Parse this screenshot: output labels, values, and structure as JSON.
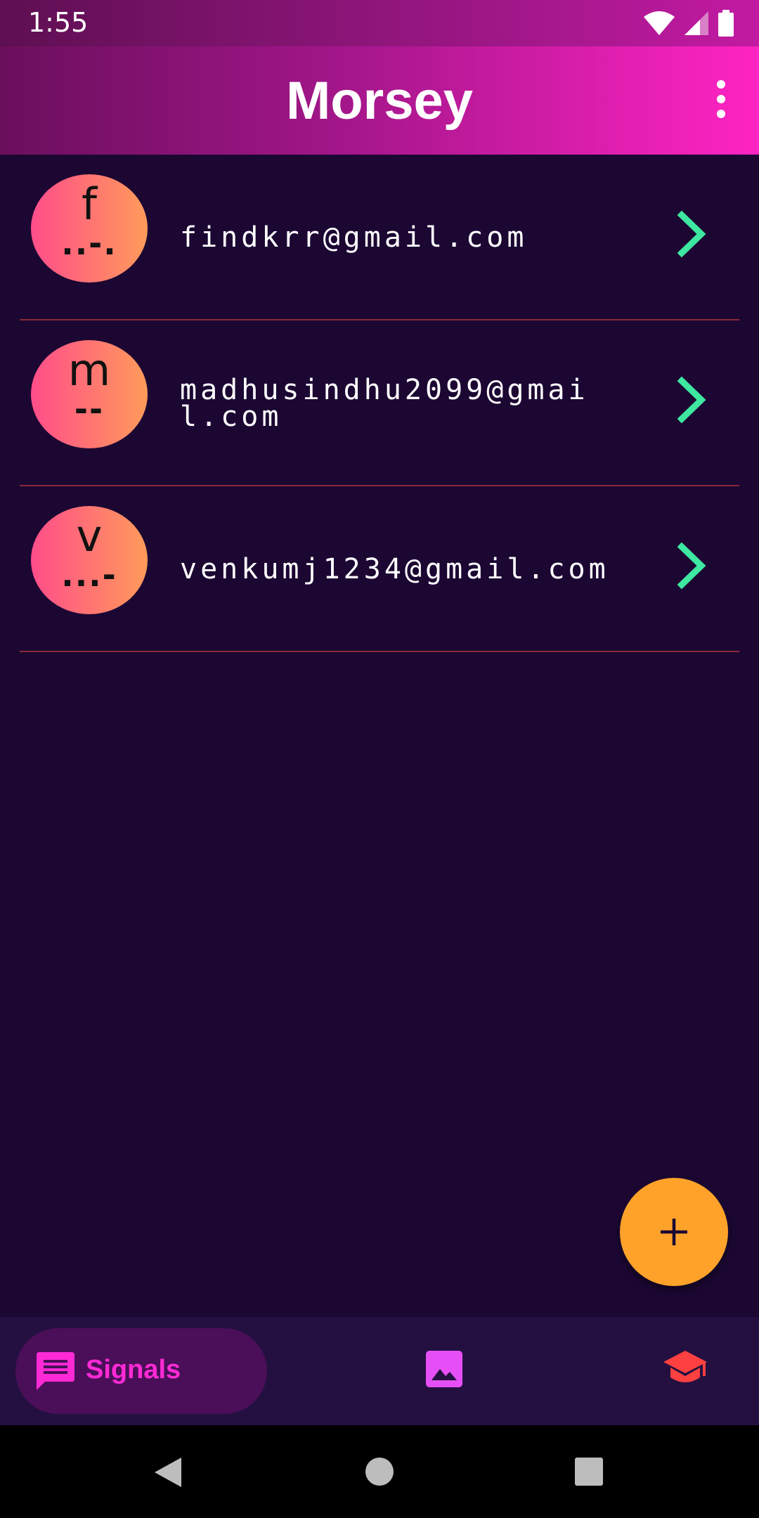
{
  "status_bar": {
    "time": "1:55",
    "icons": [
      "wifi-icon",
      "signal-icon",
      "battery-icon"
    ]
  },
  "app_bar": {
    "title": "Morsey",
    "menu_icon": "more-vert-icon"
  },
  "contacts": [
    {
      "letter": "f",
      "morse": "..-.",
      "email": "findkrr@gmail.com"
    },
    {
      "letter": "m",
      "morse": "--",
      "email": "madhusindhu2099@gmail.com"
    },
    {
      "letter": "v",
      "morse": "...-",
      "email": "venkumj1234@gmail.com"
    }
  ],
  "fab": {
    "icon": "add-icon"
  },
  "bottom_nav": {
    "signals_label": "Signals",
    "items": [
      "message-icon",
      "image-icon",
      "school-icon"
    ]
  },
  "colors": {
    "background": "#1c0733",
    "accent": "#ff24c3",
    "fab": "#ffa22a",
    "chevron": "#3ee8a0",
    "divider": "#8a2a35"
  }
}
